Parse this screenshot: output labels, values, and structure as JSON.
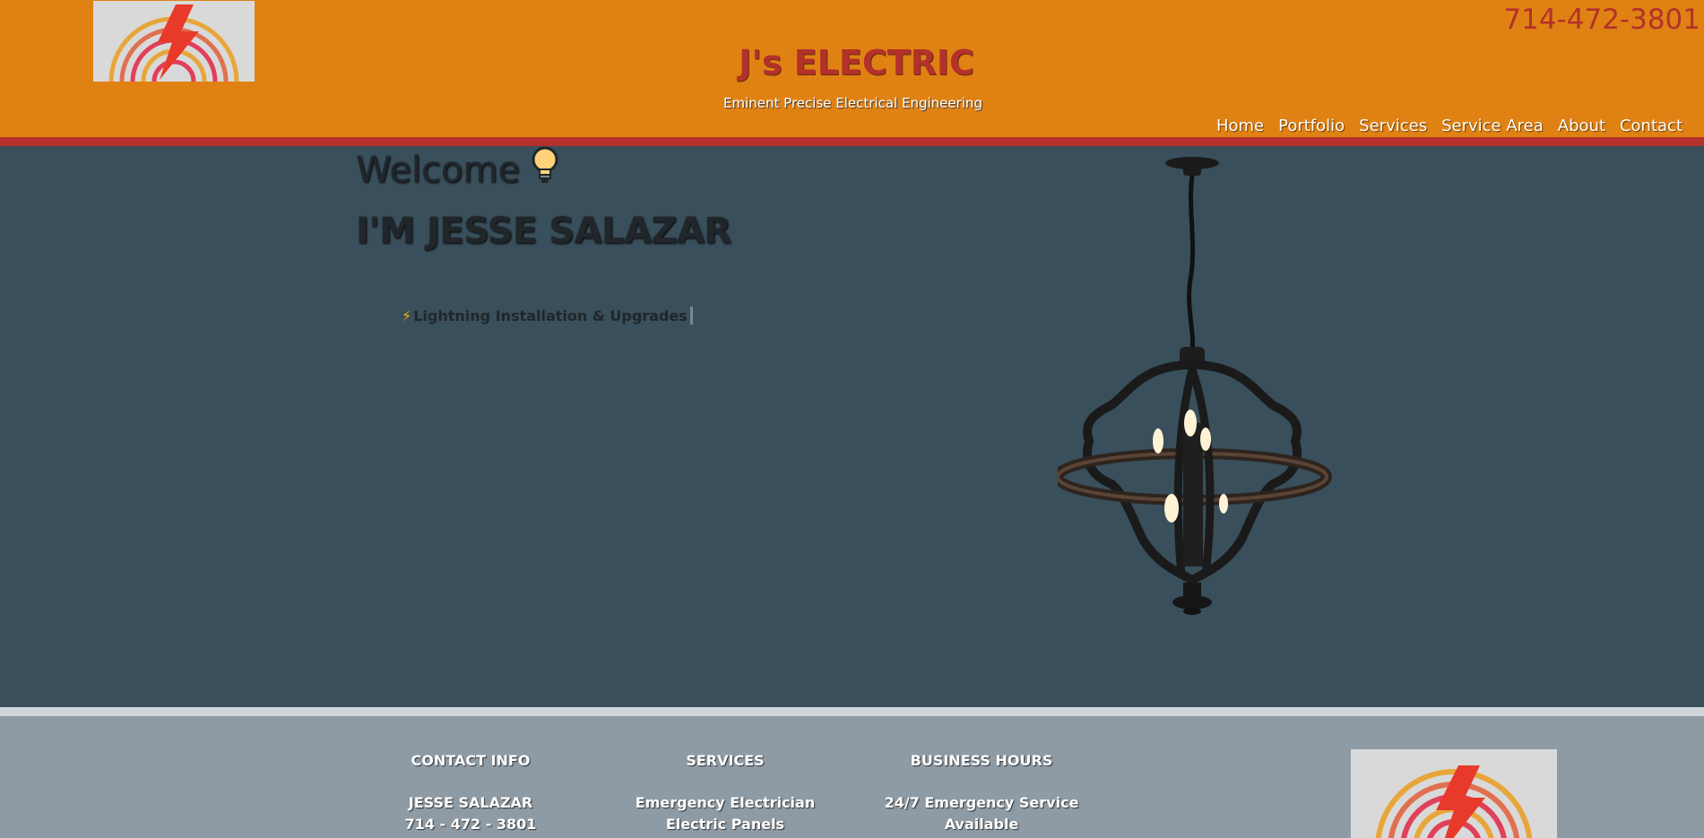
{
  "header": {
    "logo_icon": "lightning-arcs-logo",
    "phone": "714-472-3801",
    "brand": "J's ELECTRIC",
    "tagline": "Eminent Precise Electrical Engineering",
    "nav": [
      "Home",
      "Portfolio",
      "Services",
      "Service Area",
      "About",
      "Contact"
    ]
  },
  "hero": {
    "welcome": "Welcome",
    "welcome_icon": "light-bulb-icon",
    "name": "I'M JESSE SALAZAR",
    "typed_icon": "⚡",
    "typed_text": "Lightning Installation & Upgrades",
    "image": "chandelier-photo"
  },
  "footer": {
    "contact": {
      "heading": "CONTACT INFO",
      "lines": [
        "JESSE SALAZAR",
        "714 - 472 - 3801"
      ]
    },
    "services": {
      "heading": "SERVICES",
      "lines": [
        "Emergency Electrician",
        "Electric Panels"
      ]
    },
    "hours": {
      "heading": "BUSINESS HOURS",
      "lines": [
        "24/7 Emergency Service",
        "Available"
      ]
    },
    "logo_icon": "lightning-arcs-logo"
  },
  "colors": {
    "header_orange": "#e08213",
    "accent_red": "#b3312a",
    "hero_bg": "#394f5b",
    "footer_bg": "#8e9ba5"
  }
}
